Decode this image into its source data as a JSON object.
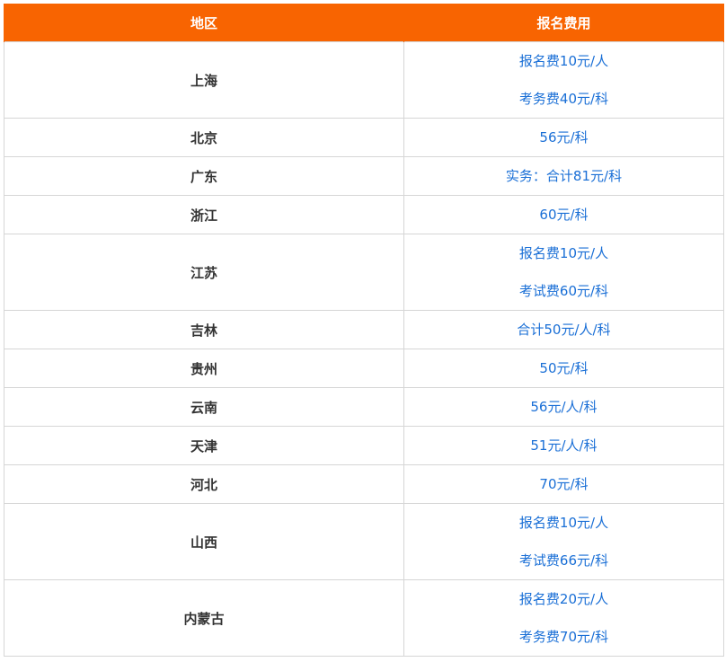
{
  "table": {
    "headers": {
      "region": "地区",
      "fee": "报名费用"
    },
    "rows": [
      {
        "region": "上海",
        "fees": [
          "报名费10元/人",
          "考务费40元/科"
        ]
      },
      {
        "region": "北京",
        "fees": [
          "56元/科"
        ]
      },
      {
        "region": "广东",
        "fees": [
          "实务：合计81元/科"
        ]
      },
      {
        "region": "浙江",
        "fees": [
          "60元/科"
        ]
      },
      {
        "region": "江苏",
        "fees": [
          "报名费10元/人",
          "考试费60元/科"
        ]
      },
      {
        "region": "吉林",
        "fees": [
          "合计50元/人/科"
        ]
      },
      {
        "region": "贵州",
        "fees": [
          "50元/科"
        ]
      },
      {
        "region": "云南",
        "fees": [
          "56元/人/科"
        ]
      },
      {
        "region": "天津",
        "fees": [
          "51元/人/科"
        ]
      },
      {
        "region": "河北",
        "fees": [
          "70元/科"
        ]
      },
      {
        "region": "山西",
        "fees": [
          "报名费10元/人",
          "考试费66元/科"
        ]
      },
      {
        "region": "内蒙古",
        "fees": [
          "报名费20元/人",
          "考务费70元/科"
        ]
      }
    ]
  },
  "colors": {
    "header_bg": "#f86401",
    "header_text": "#ffffff",
    "region_text": "#333333",
    "fee_text": "#1a6fd6",
    "border": "#d6d6d6"
  }
}
